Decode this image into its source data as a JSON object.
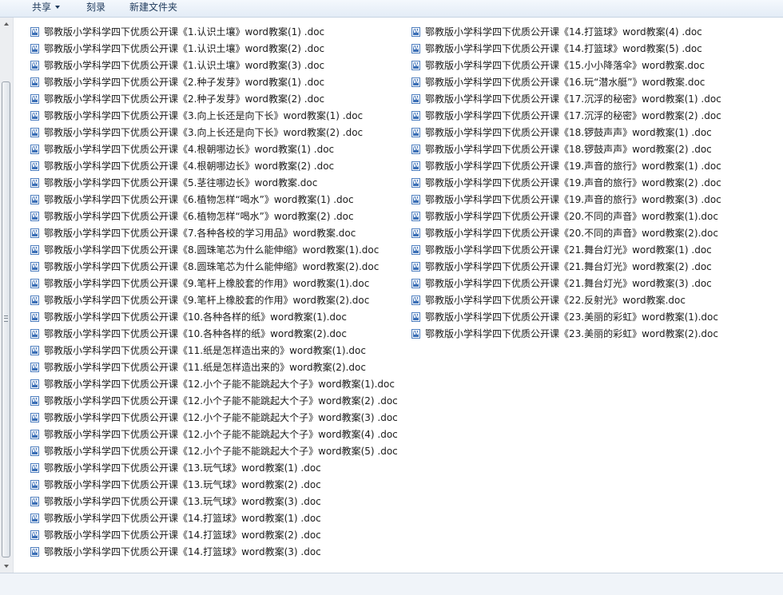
{
  "toolbar": {
    "share_label": "共享",
    "burn_label": "刻录",
    "new_folder_label": "新建文件夹"
  },
  "files": {
    "col1": [
      "鄂教版小学科学四下优质公开课《1.认识土壤》word教案(1) .doc",
      "鄂教版小学科学四下优质公开课《1.认识土壤》word教案(2) .doc",
      "鄂教版小学科学四下优质公开课《1.认识土壤》word教案(3) .doc",
      "鄂教版小学科学四下优质公开课《2.种子发芽》word教案(1) .doc",
      "鄂教版小学科学四下优质公开课《2.种子发芽》word教案(2) .doc",
      "鄂教版小学科学四下优质公开课《3.向上长还是向下长》word教案(1) .doc",
      "鄂教版小学科学四下优质公开课《3.向上长还是向下长》word教案(2) .doc",
      "鄂教版小学科学四下优质公开课《4.根朝哪边长》word教案(1) .doc",
      "鄂教版小学科学四下优质公开课《4.根朝哪边长》word教案(2) .doc",
      "鄂教版小学科学四下优质公开课《5.茎往哪边长》word教案.doc",
      "鄂教版小学科学四下优质公开课《6.植物怎样“喝水”》word教案(1) .doc",
      "鄂教版小学科学四下优质公开课《6.植物怎样“喝水”》word教案(2) .doc",
      "鄂教版小学科学四下优质公开课《7.各种各校的学习用品》word教案.doc",
      "鄂教版小学科学四下优质公开课《8.圆珠笔芯为什么能伸缩》word教案(1).doc",
      "鄂教版小学科学四下优质公开课《8.圆珠笔芯为什么能伸缩》word教案(2).doc",
      "鄂教版小学科学四下优质公开课《9.笔杆上橡胶套的作用》word教案(1).doc",
      "鄂教版小学科学四下优质公开课《9.笔杆上橡胶套的作用》word教案(2).doc",
      "鄂教版小学科学四下优质公开课《10.各种各样的纸》word教案(1).doc",
      "鄂教版小学科学四下优质公开课《10.各种各样的纸》word教案(2).doc",
      "鄂教版小学科学四下优质公开课《11.纸是怎样造出来的》word教案(1).doc",
      "鄂教版小学科学四下优质公开课《11.纸是怎样造出来的》word教案(2).doc",
      "鄂教版小学科学四下优质公开课《12.小个子能不能跳起大个子》word教案(1).doc",
      "鄂教版小学科学四下优质公开课《12.小个子能不能跳起大个子》word教案(2) .doc",
      "鄂教版小学科学四下优质公开课《12.小个子能不能跳起大个子》word教案(3) .doc",
      "鄂教版小学科学四下优质公开课《12.小个子能不能跳起大个子》word教案(4) .doc",
      "鄂教版小学科学四下优质公开课《12.小个子能不能跳起大个子》word教案(5) .doc",
      "鄂教版小学科学四下优质公开课《13.玩气球》word教案(1) .doc",
      "鄂教版小学科学四下优质公开课《13.玩气球》word教案(2) .doc",
      "鄂教版小学科学四下优质公开课《13.玩气球》word教案(3) .doc",
      "鄂教版小学科学四下优质公开课《14.打篮球》word教案(1) .doc",
      "鄂教版小学科学四下优质公开课《14.打篮球》word教案(2) .doc",
      "鄂教版小学科学四下优质公开课《14.打篮球》word教案(3) .doc"
    ],
    "col2": [
      "鄂教版小学科学四下优质公开课《14.打篮球》word教案(4) .doc",
      "鄂教版小学科学四下优质公开课《14.打篮球》word教案(5) .doc",
      "鄂教版小学科学四下优质公开课《15.小小降落伞》word教案.doc",
      "鄂教版小学科学四下优质公开课《16.玩“潜水艇”》word教案.doc",
      "鄂教版小学科学四下优质公开课《17.沉浮的秘密》word教案(1) .doc",
      "鄂教版小学科学四下优质公开课《17.沉浮的秘密》word教案(2) .doc",
      "鄂教版小学科学四下优质公开课《18.锣鼓声声》word教案(1) .doc",
      "鄂教版小学科学四下优质公开课《18.锣鼓声声》word教案(2) .doc",
      "鄂教版小学科学四下优质公开课《19.声音的旅行》word教案(1) .doc",
      "鄂教版小学科学四下优质公开课《19.声音的旅行》word教案(2) .doc",
      "鄂教版小学科学四下优质公开课《19.声音的旅行》word教案(3) .doc",
      "鄂教版小学科学四下优质公开课《20.不同的声音》word教案(1).doc",
      "鄂教版小学科学四下优质公开课《20.不同的声音》word教案(2).doc",
      "鄂教版小学科学四下优质公开课《21.舞台灯光》word教案(1) .doc",
      "鄂教版小学科学四下优质公开课《21.舞台灯光》word教案(2) .doc",
      "鄂教版小学科学四下优质公开课《21.舞台灯光》word教案(3) .doc",
      "鄂教版小学科学四下优质公开课《22.反射光》word教案.doc",
      "鄂教版小学科学四下优质公开课《23.美丽的彩虹》word教案(1).doc",
      "鄂教版小学科学四下优质公开课《23.美丽的彩虹》word教案(2).doc"
    ]
  }
}
